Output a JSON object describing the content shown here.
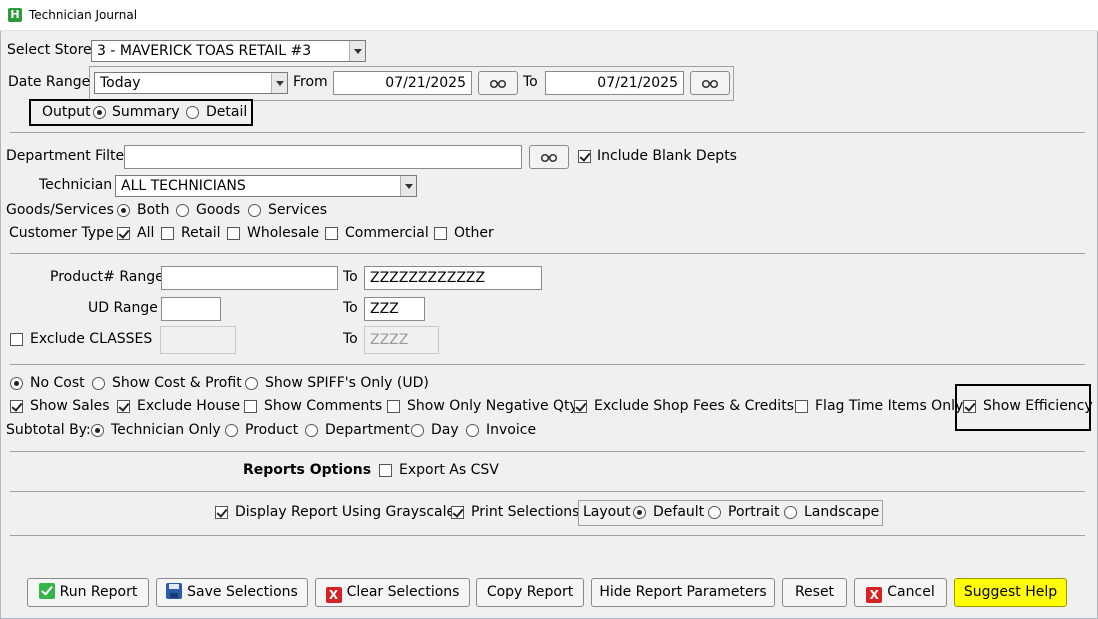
{
  "window": {
    "title": "Technician Journal",
    "app_icon_letter": "H"
  },
  "store": {
    "label": "Select Store",
    "value": "3 - MAVERICK TOAS RETAIL #3"
  },
  "date_range": {
    "label": "Date Range",
    "value": "Today",
    "from_label": "From",
    "from_value": "07/21/2025",
    "to_label": "To",
    "to_value": "07/21/2025"
  },
  "output": {
    "label": "Output",
    "summary": "Summary",
    "detail": "Detail",
    "selected": "Summary"
  },
  "department": {
    "label": "Department Filter",
    "value": "",
    "include_blank_label": "Include Blank Depts",
    "include_blank": true
  },
  "technician": {
    "label": "Technician",
    "value": "ALL TECHNICIANS"
  },
  "goods_services": {
    "label": "Goods/Services",
    "options": [
      "Both",
      "Goods",
      "Services"
    ],
    "selected": "Both"
  },
  "customer_type": {
    "label": "Customer Type",
    "all": "All",
    "retail": "Retail",
    "wholesale": "Wholesale",
    "commercial": "Commercial",
    "other": "Other",
    "checked": [
      "All"
    ]
  },
  "product_range": {
    "label": "Product# Range",
    "from": "",
    "to_label": "To",
    "to": "ZZZZZZZZZZZZ"
  },
  "ud_range": {
    "label": "UD Range",
    "from": "",
    "to_label": "To",
    "to": "ZZZ"
  },
  "classes": {
    "label": "Exclude CLASSES",
    "from": "",
    "to_label": "To",
    "to": "ZZZZ",
    "checked": false
  },
  "cost": {
    "no_cost": "No Cost",
    "cost_profit": "Show Cost & Profit",
    "spiff": "Show SPIFF's Only (UD)",
    "selected": "No Cost"
  },
  "show_flags": {
    "show_sales": "Show Sales",
    "exclude_house": "Exclude House",
    "show_comments": "Show Comments",
    "negative_qty": "Show Only Negative Qty",
    "exclude_fees": "Exclude Shop Fees & Credits",
    "flag_time": "Flag Time Items Only",
    "show_efficiency": "Show Efficiency"
  },
  "subtotal": {
    "label": "Subtotal By:",
    "technician": "Technician Only",
    "product": "Product",
    "department": "Department",
    "day": "Day",
    "invoice": "Invoice",
    "selected": "Technician Only"
  },
  "reports_options": {
    "label": "Reports Options",
    "export_csv": "Export As CSV"
  },
  "print": {
    "grayscale": "Display Report Using Grayscale",
    "print_selections": "Print Selections",
    "layout_label": "Layout",
    "default": "Default",
    "portrait": "Portrait",
    "landscape": "Landscape",
    "selected": "Default"
  },
  "buttons": {
    "run": "Run Report",
    "save": "Save Selections",
    "clear": "Clear Selections",
    "copy": "Copy Report",
    "hide": "Hide Report Parameters",
    "reset": "Reset",
    "cancel": "Cancel",
    "help": "Suggest Help"
  },
  "colors": {
    "help_button": "#ffff00",
    "run_icon": "#34b44a",
    "cancel_icon": "#d62222"
  }
}
